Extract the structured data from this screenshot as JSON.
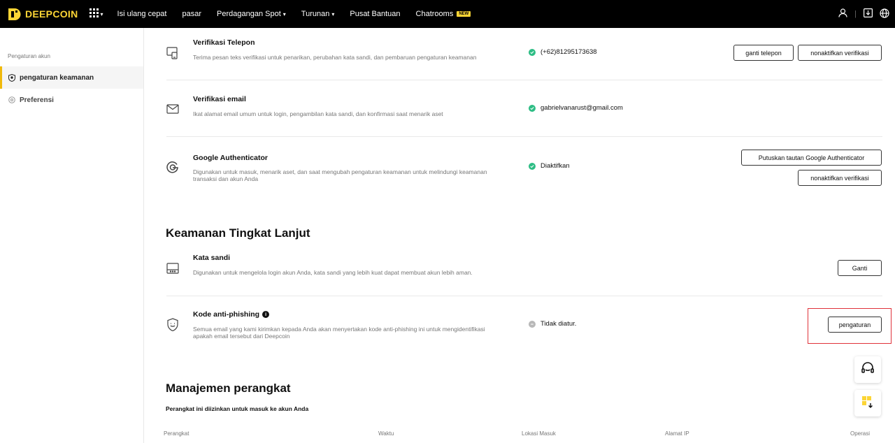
{
  "brand": {
    "name": "DEEPCOIN",
    "accent": "#fcd535"
  },
  "nav": {
    "items": [
      {
        "label": "Isi ulang cepat",
        "caret": false
      },
      {
        "label": "pasar",
        "caret": false
      },
      {
        "label": "Perdagangan Spot",
        "caret": true
      },
      {
        "label": "Turunan",
        "caret": true
      },
      {
        "label": "Pusat Bantuan",
        "caret": false
      },
      {
        "label": "Chatrooms",
        "caret": false,
        "badge": "NEW"
      }
    ]
  },
  "sidebar": {
    "section": "Pengaturan akun",
    "items": [
      {
        "label": "pengaturan keamanan",
        "active": true
      },
      {
        "label": "Preferensi",
        "active": false
      }
    ]
  },
  "verification": {
    "phone": {
      "title": "Verifikasi Telepon",
      "desc": "Terima pesan teks verifikasi untuk penarikan, perubahan kata sandi, dan pembaruan pengaturan keamanan",
      "status": "(+62)81295173638",
      "buttons": [
        "ganti telepon",
        "nonaktifkan verifikasi"
      ]
    },
    "email": {
      "title": "Verifikasi email",
      "desc": "Ikat alamat email umum untuk login, pengambilan kata sandi, dan konfirmasi saat menarik aset",
      "status": "gabrielvanarust@gmail.com"
    },
    "google": {
      "title": "Google Authenticator",
      "desc": "Digunakan untuk masuk, menarik aset, dan saat mengubah pengaturan keamanan untuk melindungi keamanan transaksi dan akun Anda",
      "status": "Diaktifkan",
      "buttons": [
        "Putuskan tautan Google Authenticator",
        "nonaktifkan verifikasi"
      ]
    }
  },
  "advanced": {
    "title": "Keamanan Tingkat Lanjut",
    "password": {
      "title": "Kata sandi",
      "desc": "Digunakan untuk mengelola login akun Anda, kata sandi yang lebih kuat dapat membuat akun lebih aman.",
      "button": "Ganti"
    },
    "antiphishing": {
      "title": "Kode anti-phishing",
      "desc": "Semua email yang kami kirimkan kepada Anda akan menyertakan kode anti-phishing ini untuk mengidentifikasi apakah email tersebut dari Deepcoin",
      "status": "Tidak diatur.",
      "button": "pengaturan"
    }
  },
  "devices": {
    "title": "Manajemen perangkat",
    "subtitle": "Perangkat ini diizinkan untuk masuk ke akun Anda",
    "columns": [
      "Perangkat",
      "Waktu",
      "Lokasi Masuk",
      "Alamat IP",
      "Operasi"
    ]
  },
  "colors": {
    "success": "#2ebd85",
    "highlight": "#e0323a",
    "inactive": "#b8b8b8"
  }
}
